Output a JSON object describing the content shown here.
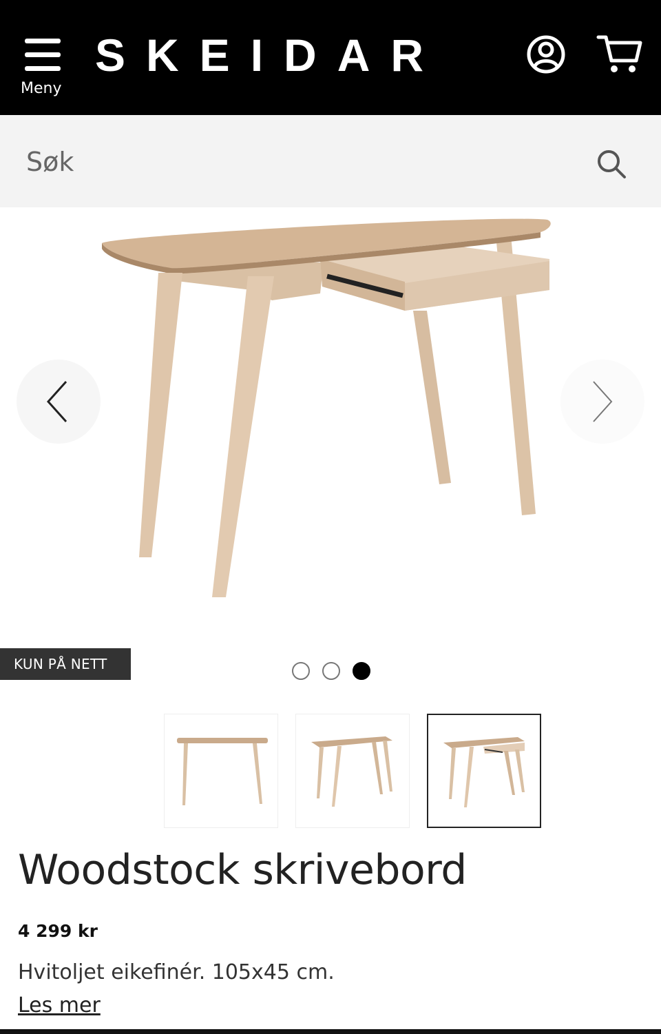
{
  "header": {
    "menu_label": "Meny",
    "logo_text": "SKEIDAR",
    "account_icon": "account-icon",
    "cart_icon": "cart-icon",
    "background": "#000000"
  },
  "search": {
    "placeholder": "Søk",
    "icon": "search-icon"
  },
  "gallery": {
    "prev_icon": "chevron-left-icon",
    "next_icon": "chevron-right-icon",
    "badge": "KUN PÅ NETT",
    "dots": 3,
    "active_dot": 3,
    "thumbnail_count": 3,
    "selected_thumbnail": 3
  },
  "product": {
    "title": "Woodstock skrivebord",
    "price": "4 299 kr",
    "description": "Hvitoljet eikefinér. 105x45 cm.",
    "read_more": "Les mer"
  },
  "colors": {
    "wood_light": "#e3cdb6",
    "wood_mid": "#d6bca0",
    "wood_dark": "#b89a7c",
    "badge_bg": "#333333"
  }
}
